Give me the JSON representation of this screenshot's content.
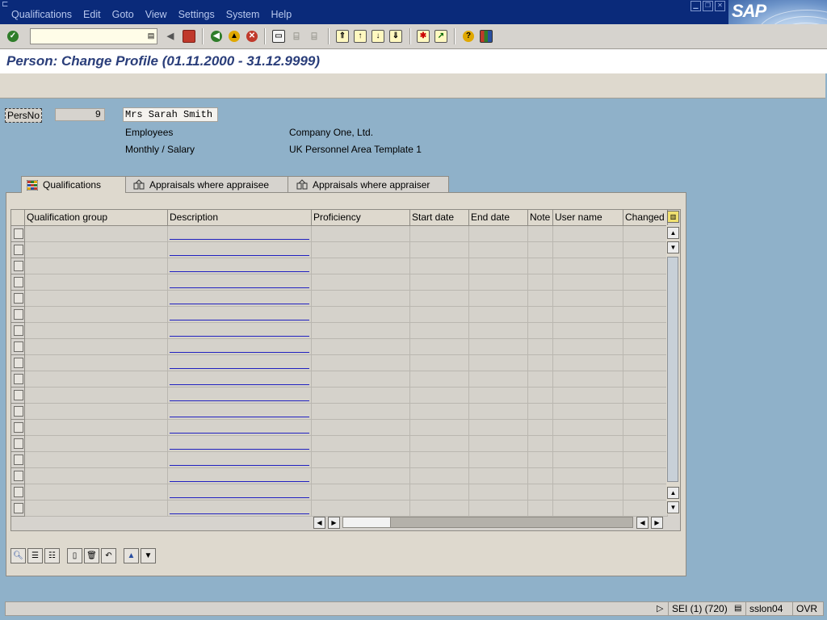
{
  "menu": {
    "items": [
      "Qualifications",
      "Edit",
      "Goto",
      "View",
      "Settings",
      "System",
      "Help"
    ]
  },
  "brand": {
    "logo_text": "SAP"
  },
  "colors": {
    "menubar": "#0a2a7a",
    "title": "#2a3e7a",
    "background": "#8fb1c9",
    "link_underline": "#2020c0"
  },
  "toolbar": {
    "command_value": "",
    "icons": [
      "enter-icon",
      "back-arrow-icon",
      "save-icon",
      "back-icon",
      "exit-icon",
      "cancel-icon",
      "print-icon",
      "find-icon",
      "find-next-icon",
      "first-page-icon",
      "previous-page-icon",
      "next-page-icon",
      "last-page-icon",
      "new-session-icon",
      "shortcut-icon",
      "help-icon",
      "layout-icon"
    ]
  },
  "page": {
    "title": "Person: Change Profile (01.11.2000 - 31.12.9999)"
  },
  "header": {
    "persno_label": "PersNo",
    "persno_value": "9",
    "name": "Mrs Sarah Smith",
    "employee_group": "Employees",
    "company": "Company One, Ltd.",
    "payroll": "Monthly / Salary",
    "personnel_area": "UK Personnel Area Template 1"
  },
  "tabs": [
    {
      "label": "Qualifications",
      "active": true,
      "icon": "qualifications-icon"
    },
    {
      "label": "Appraisals where appraisee",
      "active": false,
      "icon": "appraisal-icon"
    },
    {
      "label": "Appraisals where appraiser",
      "active": false,
      "icon": "appraisal-icon"
    }
  ],
  "table": {
    "columns": [
      "Qualification group",
      "Description",
      "Proficiency",
      "Start date",
      "End date",
      "Note",
      "User name",
      "Changed"
    ],
    "row_count": 18
  },
  "table_buttons": [
    "details-icon",
    "select-all-icon",
    "deselect-all-icon",
    "new-entry-icon",
    "delete-icon",
    "undo-icon",
    "sort-ascending-icon",
    "filter-icon"
  ],
  "status": {
    "system": "SEI (1) (720)",
    "server": "sslon04",
    "mode": "OVR"
  }
}
